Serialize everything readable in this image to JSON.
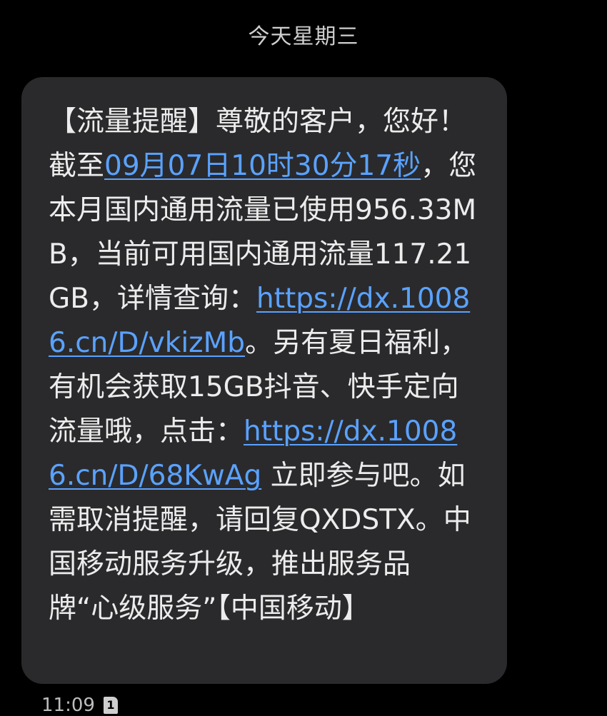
{
  "header": {
    "day_label": "今天星期三"
  },
  "message": {
    "segments": [
      {
        "type": "text",
        "value": "【流量提醒】尊敬的客户，您好！截至"
      },
      {
        "type": "link",
        "value": "09月07日10时30分17秒"
      },
      {
        "type": "text",
        "value": "，您本月国内通用流量已使用956.33MB，当前可用国内通用流量117.21GB，详情查询："
      },
      {
        "type": "link",
        "value": "https://dx.10086.cn/D/vkizMb"
      },
      {
        "type": "text",
        "value": "。另有夏日福利，有机会获取15GB抖音、快手定向流量哦，点击："
      },
      {
        "type": "link",
        "value": "https://dx.10086.cn/D/68KwAg"
      },
      {
        "type": "text",
        "value": " 立即参与吧。如需取消提醒，请回复QXDSTX。中国移动服务升级，推出服务品牌“心级服务”【中国移动】"
      }
    ]
  },
  "meta": {
    "time": "11:09",
    "sim_icon": "sim-card-icon",
    "sim_slot": "1"
  },
  "colors": {
    "background": "#000000",
    "bubble": "#2a2a2c",
    "text": "#ececec",
    "link": "#5aa2ff"
  }
}
